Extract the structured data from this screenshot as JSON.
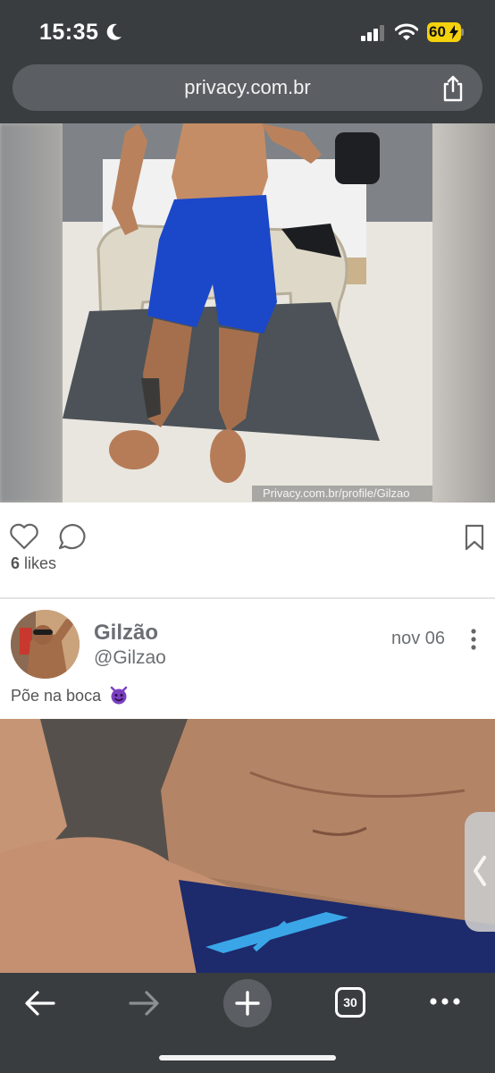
{
  "status_bar": {
    "time": "15:35",
    "battery": "60"
  },
  "browser": {
    "url": "privacy.com.br",
    "tab_count": "30"
  },
  "post1": {
    "watermark": "Privacy.com.br/profile/Gilzao",
    "likes_count": "6",
    "likes_label": "likes"
  },
  "post2": {
    "author_name": "Gilzão",
    "author_handle": "@Gilzao",
    "date": "nov 06",
    "caption": "Põe na boca"
  },
  "icons": {
    "status": [
      "moon-icon",
      "signal-icon",
      "wifi-icon",
      "battery-icon"
    ],
    "post_actions": [
      "heart-icon",
      "comment-icon",
      "bookmark-icon"
    ],
    "toolbar": [
      "back-arrow-icon",
      "forward-arrow-icon",
      "plus-icon",
      "tabs-icon",
      "more-icon"
    ]
  },
  "colors": {
    "chrome": "#3a3d40",
    "url_bar": "#5b5e62",
    "battery": "#f5d20b",
    "text_muted": "#6b6f73"
  }
}
